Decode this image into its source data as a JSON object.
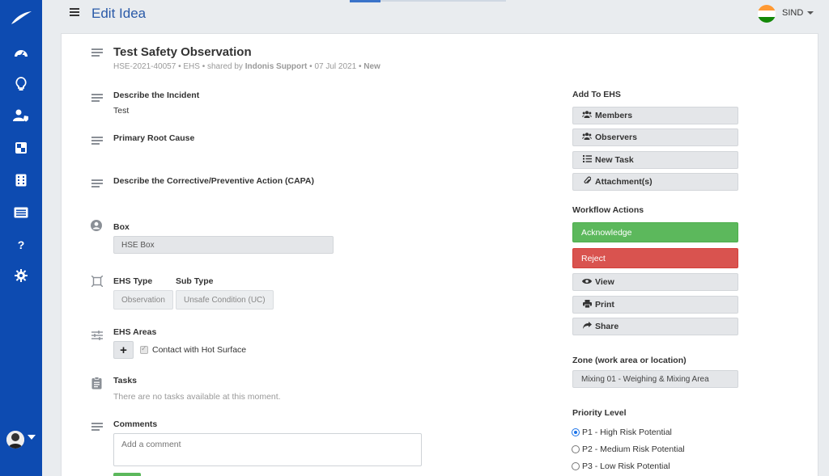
{
  "header": {
    "title": "Edit Idea",
    "user": "SIND"
  },
  "sidebar": {
    "items": [
      {
        "name": "dashboard-icon"
      },
      {
        "name": "lightbulb-icon"
      },
      {
        "name": "user-shield-icon"
      },
      {
        "name": "grid-icon"
      },
      {
        "name": "calculator-icon"
      },
      {
        "name": "list-card-icon"
      },
      {
        "name": "help-icon",
        "glyph": "?"
      },
      {
        "name": "gear-icon"
      }
    ]
  },
  "idea": {
    "title": "Test Safety Observation",
    "meta_id": "HSE-2021-40057",
    "meta_type": "EHS",
    "meta_shared_prefix": "shared by",
    "meta_shared_by": "Indonis Support",
    "meta_date": "07 Jul 2021",
    "meta_status": "New",
    "sep": "•"
  },
  "fields": {
    "incident_label": "Describe the Incident",
    "incident_value": "Test",
    "root_cause_label": "Primary Root Cause",
    "capa_label": "Describe the Corrective/Preventive Action (CAPA)",
    "box_label": "Box",
    "box_value": "HSE Box",
    "ehs_type_label": "EHS Type",
    "ehs_type_value": "Observation",
    "sub_type_label": "Sub Type",
    "sub_type_value": "Unsafe Condition (UC)",
    "ehs_areas_label": "EHS Areas",
    "ehs_area_item": "Contact with Hot Surface",
    "tasks_label": "Tasks",
    "tasks_empty": "There are no tasks available at this moment.",
    "comments_label": "Comments",
    "comment_placeholder": "Add a comment"
  },
  "right": {
    "add_to_label": "Add To EHS",
    "members": "Members",
    "observers": "Observers",
    "new_task": "New Task",
    "attachments": "Attachment(s)",
    "workflow_label": "Workflow Actions",
    "acknowledge": "Acknowledge",
    "reject": "Reject",
    "view": "View",
    "print": "Print",
    "share": "Share",
    "zone_label": "Zone (work area or location)",
    "zone_value": "Mixing 01 - Weighing & Mixing Area",
    "priority_label": "Priority Level",
    "priorities": [
      {
        "label": "P1 - High Risk Potential",
        "selected": true
      },
      {
        "label": "P2 - Medium Risk Potential",
        "selected": false
      },
      {
        "label": "P3 - Low Risk Potential",
        "selected": false
      }
    ]
  },
  "colors": {
    "sidebar": "#0d4bb1",
    "accent": "#2a5aa8",
    "success": "#5cb85c",
    "danger": "#d9534f"
  }
}
